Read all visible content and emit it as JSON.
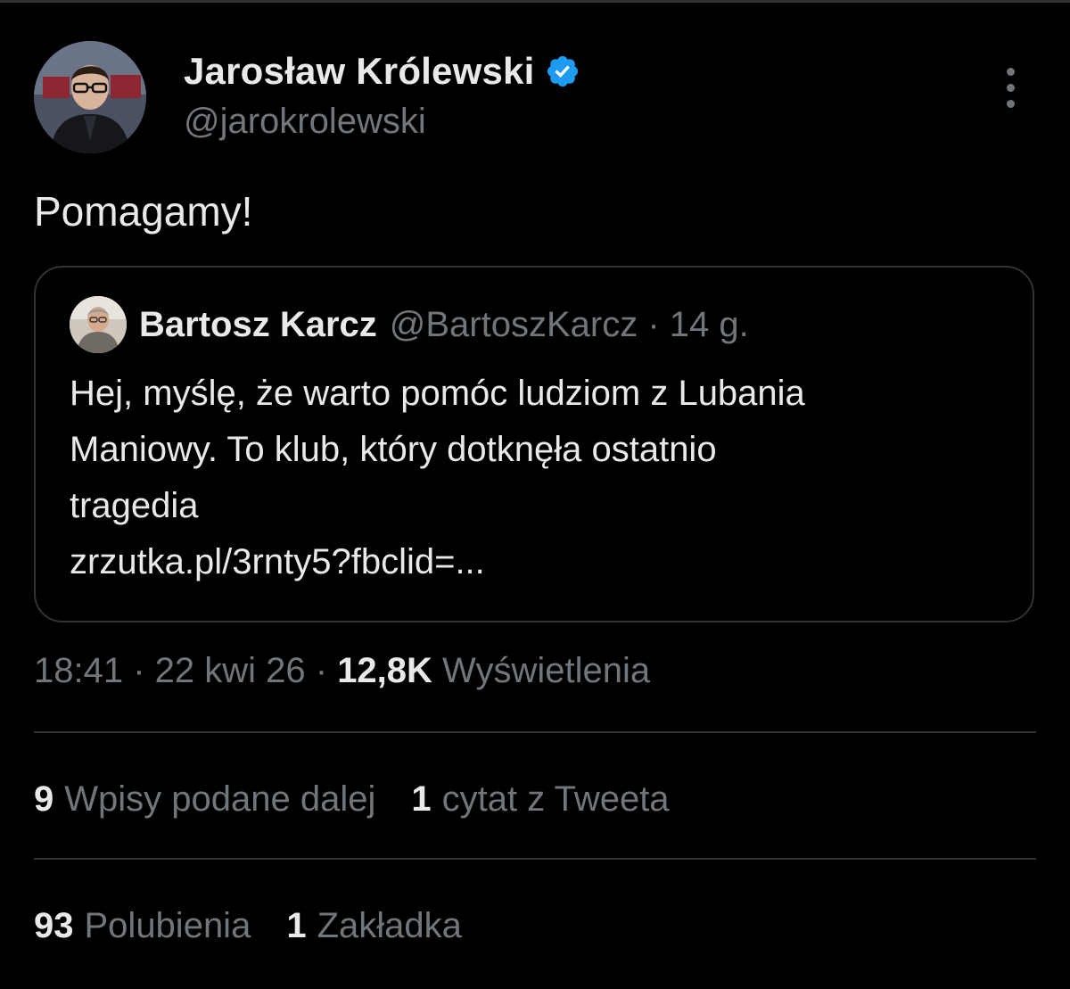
{
  "tweet": {
    "author": {
      "display_name": "Jarosław Królewski",
      "handle": "@jarokrolewski",
      "verified": true,
      "avatar": "person-dark-jacket-glasses"
    },
    "more_icon": "more-vertical-icon",
    "text": "Pomagamy!",
    "quoted_tweet": {
      "author_name": "Bartosz Karcz",
      "meta": "@BartoszKarcz · 14 g.",
      "lines": [
        "Hej, myślę, że warto pomóc ludziom z Lubania",
        "Maniowy. To klub, który dotknęła ostatnio",
        "tragedia",
        "zrzutka.pl/3rnty5?fbclid=..."
      ]
    },
    "timestamp": "18:41 · 22 kwi 26 · ",
    "views_count": "12,8K",
    "views_label": " Wyświetlenia",
    "stats": {
      "retweets_count": "9",
      "retweets_label": "Wpisy podane dalej",
      "quotes_count": "1",
      "quotes_label": "cytat z Tweeta",
      "likes_count": "93",
      "likes_label": "Polubienia",
      "bookmarks_count": "1",
      "bookmarks_label": "Zakładka"
    }
  },
  "colors": {
    "background": "#000000",
    "primary_text": "#e7e9ea",
    "secondary_text": "#71767b",
    "border": "#2f3336",
    "verified_blue": "#1d9bf0"
  }
}
